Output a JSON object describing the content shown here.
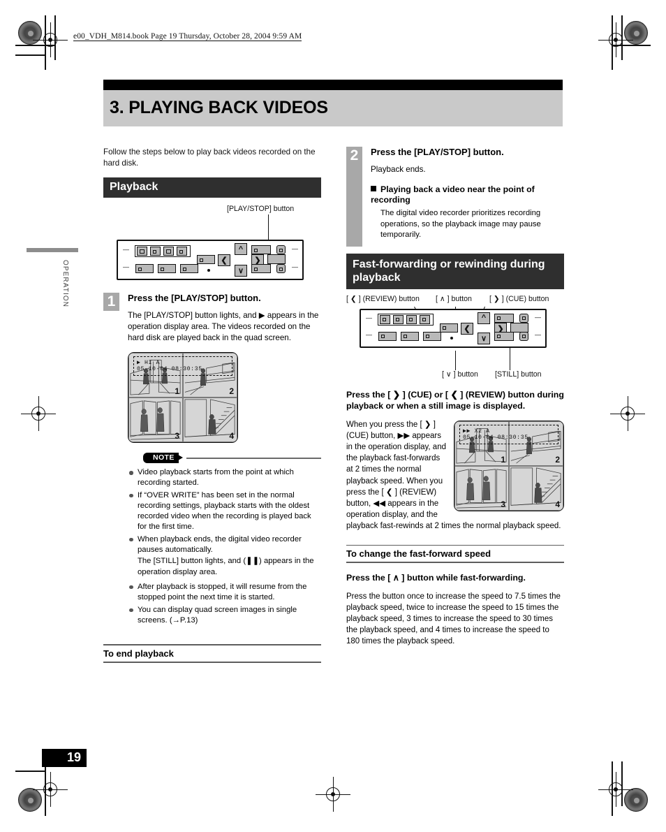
{
  "document": {
    "file_header": "e00_VDH_M814.book  Page 19  Thursday, October 28, 2004  9:59 AM",
    "page_number": "19",
    "side_tab": "OPERATION",
    "chapter_title": "3. PLAYING BACK VIDEOS"
  },
  "left": {
    "intro": "Follow the steps below to play back videos recorded on the hard disk.",
    "section_title": "Playback",
    "diagram_callout": "[PLAY/STOP] button",
    "step1": {
      "number": "1",
      "title": "Press the [PLAY/STOP] button.",
      "body": "The [PLAY/STOP] button lights, and ▶ appears in the operation display area. The videos recorded on the hard disk are played back in the quad screen."
    },
    "quad_screen": {
      "osd_line1": "▶            HI      A",
      "osd_line2": "05-10-04  08:30:35",
      "cells": [
        "1",
        "2",
        "3",
        "4"
      ]
    },
    "note": {
      "label": "NOTE",
      "items": [
        "Video playback starts from the point at which recording started.",
        "If “OVER WRITE” has been set in the normal recording settings, playback starts with the oldest recorded video when the recording is played back for the first time.",
        "When playback ends, the digital video recorder pauses automatically.",
        "After playback is stopped, it will resume from the stopped point the next time it is started.",
        "You can display quad screen images in single screens. (→P.13)"
      ],
      "sub_note": "The [STILL] button lights, and (❚❚) appears in the operation display area."
    },
    "end_playback_head": "To end playback"
  },
  "right": {
    "step2": {
      "number": "2",
      "title": "Press the [PLAY/STOP] button.",
      "body": "Playback ends.",
      "sub_head": "Playing back a video near the point of recording",
      "sub_body": "The digital video recorder prioritizes recording operations, so the playback image may pause temporarily."
    },
    "section_title": "Fast-forwarding or rewinding during playback",
    "callouts": {
      "review": "[ ❮ ] (REVIEW) button",
      "up": "[ ∧ ] button",
      "cue": "[ ❯ ] (CUE) button",
      "down": "[ ∨ ] button",
      "still": "[STILL] button"
    },
    "bold_instruction": "Press the [ ❯ ] (CUE) or [ ❮ ] (REVIEW) button during playback or when a still image is displayed.",
    "flow_text": "When you press the [ ❯ ] (CUE) button, ▶▶ appears in the operation display, and the playback fast-forwards at 2 times the normal playback speed. When you press the [ ❮ ] (REVIEW) button, ◀◀ appears in the operation display, and the playback fast-rewinds at 2 times the normal playback speed.",
    "quad_screen": {
      "osd_line1": "▶▶  X2              A",
      "osd_line2": "05-10-04  08:30:35",
      "cells": [
        "1",
        "2",
        "3",
        "4"
      ]
    },
    "speed_head": "To change the fast-forward speed",
    "speed_bold": "Press the [ ∧ ] button while fast-forwarding.",
    "speed_body": "Press the button once to increase the speed to 7.5 times the playback speed, twice to increase the speed to 15 times the playback speed, 3 times to increase the speed to 30 times the playback speed, and 4 times to increase the speed to 180 times the playback speed."
  },
  "colors": {
    "section_bar": "#2f2f2f",
    "chapter_band": "#c9c9c9",
    "step_num_bg": "#a8a8a8",
    "button_face": "#b9b9b9"
  }
}
